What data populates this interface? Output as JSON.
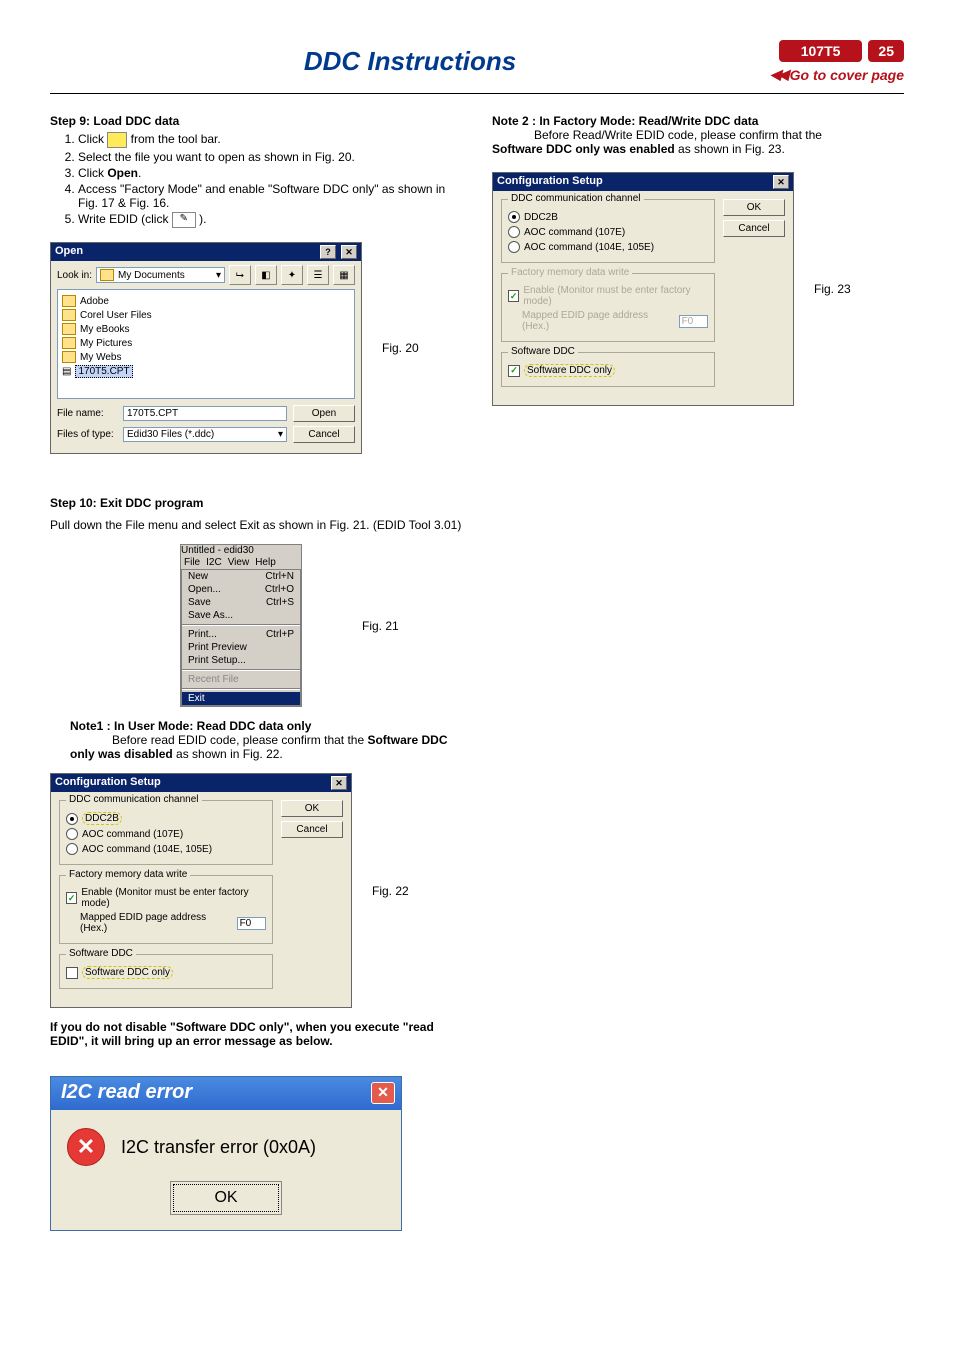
{
  "header": {
    "title": "DDC Instructions",
    "model": "107T5",
    "page": "25",
    "cover_link": "Go to cover page"
  },
  "left": {
    "step9": {
      "title": "Step 9: Load DDC data",
      "items": [
        "Click __ICON__  from the tool bar.",
        "Select the file you want to open as shown in Fig. 20.",
        "Click Open.",
        "Access \"Factory Mode\" and enable \"Software DDC only\" as shown in Fig. 17 & Fig. 16.",
        "Write EDID (click __ICON2__  )."
      ],
      "open_text": "Open"
    },
    "fig20_label": "Fig. 20",
    "open_dialog": {
      "title": "Open",
      "look_in_label": "Look in:",
      "look_in_value": "My Documents",
      "folders": [
        "Adobe",
        "Corel User Files",
        "My eBooks",
        "My Pictures",
        "My Webs"
      ],
      "selected_file": "170T5.CPT",
      "file_name_label": "File name:",
      "file_name_value": "170T5.CPT",
      "file_type_label": "Files of type:",
      "file_type_value": "Edid30 Files (*.ddc)",
      "open_btn": "Open",
      "cancel_btn": "Cancel"
    },
    "step10": {
      "title": "Step 10: Exit DDC program",
      "body": " Pull down the File menu and select Exit as shown in Fig. 21. (EDID Tool 3.01)"
    },
    "fig21_label": "Fig. 21",
    "edid_menu": {
      "title": "Untitled - edid30",
      "menubar": [
        "File",
        "I2C",
        "View",
        "Help"
      ],
      "items": [
        {
          "label": "New",
          "accel": "Ctrl+N"
        },
        {
          "label": "Open...",
          "accel": "Ctrl+O"
        },
        {
          "label": "Save",
          "accel": "Ctrl+S"
        },
        {
          "label": "Save As...",
          "accel": ""
        }
      ],
      "items2": [
        {
          "label": "Print...",
          "accel": "Ctrl+P"
        },
        {
          "label": "Print Preview",
          "accel": ""
        },
        {
          "label": "Print Setup...",
          "accel": ""
        }
      ],
      "recent": "Recent File",
      "exit": "Exit"
    },
    "note1_title": "Note1 : In User Mode: Read DDC data only",
    "note1_l1": "Before read EDID code, please confirm that the ",
    "note1_bold1": "Software DDC only was disabled",
    "note1_l2": " as shown in Fig. 22.",
    "fig22_label": "Fig. 22",
    "config22": {
      "title": "Configuration Setup",
      "group1": "DDC communication channel",
      "opt1": "DDC2B",
      "opt2": "AOC command (107E)",
      "opt3": "AOC command (104E, 105E)",
      "group2": "Factory memory data write",
      "enable": "Enable (Monitor must be enter factory mode)",
      "mapped": "Mapped EDID page address (Hex.)",
      "mapped_val": "F0",
      "group3": "Software DDC",
      "swd": "Software DDC only",
      "ok": "OK",
      "cancel": "Cancel"
    },
    "warn": "If you do not disable \"Software DDC only\", when you execute \"read EDID\", it will bring up an error message as below.",
    "err": {
      "title": "I2C read error",
      "msg": "I2C transfer error (0x0A)",
      "ok": "OK"
    }
  },
  "right": {
    "note2_title": "Note 2 : In Factory Mode: Read/Write DDC data",
    "note2_l1": "Before Read/Write EDID code, please confirm that the",
    "note2_bold": "Software DDC only was enabled",
    "note2_l2": " as shown in Fig. 23.",
    "fig23_label": "Fig. 23",
    "config23": {
      "title": "Configuration Setup",
      "group1": "DDC communication channel",
      "opt1": "DDC2B",
      "opt2": "AOC command (107E)",
      "opt3": "AOC command (104E, 105E)",
      "group2": "Factory memory data write",
      "enable": "Enable (Monitor must be enter factory mode)",
      "mapped": "Mapped EDID page address (Hex.)",
      "mapped_val": "F0",
      "group3": "Software DDC",
      "swd": "Software DDC only",
      "ok": "OK",
      "cancel": "Cancel"
    }
  }
}
